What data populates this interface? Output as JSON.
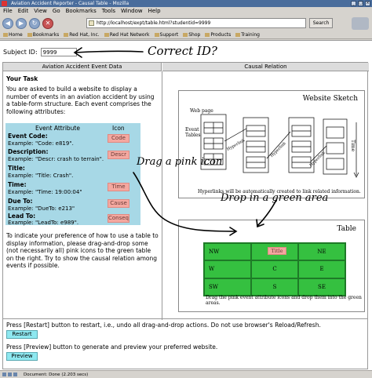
{
  "window": {
    "title": "Aviation Accident Reporter - Causal Table - Mozilla"
  },
  "menu": [
    "File",
    "Edit",
    "View",
    "Go",
    "Bookmarks",
    "Tools",
    "Window",
    "Help"
  ],
  "nav": {
    "url": "http://localhost/expt/table.html?studentid=9999",
    "search_label": "Search"
  },
  "bookmarks": [
    "Home",
    "Bookmarks",
    "Red Hat, Inc.",
    "Red Hat Network",
    "Support",
    "Shop",
    "Products",
    "Training"
  ],
  "subject": {
    "label": "Subject ID:",
    "value": "9999"
  },
  "annotations": {
    "correct_id": "Correct ID?",
    "drag": "Drag a pink icon",
    "drop": "Drop in a green area"
  },
  "left": {
    "header": "Aviation Accident Event Data",
    "task_title": "Your Task",
    "task_desc": "You are asked to build a website to display a number of events in an aviation accident by using a table-form structure. Each event comprises the following attributes:",
    "attr_header": "Event Attribute",
    "icon_header": "Icon",
    "attributes": [
      {
        "label": "Event Code:",
        "example": "Example: \"Code: e819\".",
        "icon": "Code"
      },
      {
        "label": "Description:",
        "example": "Example: \"Descr: crash to terrain\".",
        "icon": "Descr"
      },
      {
        "label": "Title:",
        "example": "Example: \"Title: Crash\".",
        "icon": ""
      },
      {
        "label": "Time:",
        "example": "Example: \"Time: 19:00:04\"",
        "icon": "Time"
      },
      {
        "label": "Due To:",
        "example": "Example: \"DueTo: e213\"",
        "icon": "Cause"
      },
      {
        "label": "Lead To:",
        "example": "Example: \"LeadTo: e989\".",
        "icon": "Conseq"
      }
    ],
    "task_foot": "To indicate your preference of how to use a table to display information, please drag-and-drop some (not necessarily all) pink icons to the green table on the right. Try to show the causal relation among events if possible."
  },
  "right": {
    "header": "Causal Relation",
    "sketch": {
      "title": "Website Sketch",
      "web_page": "Web page",
      "event_tables": "Event Tables",
      "time": "Time",
      "hyperlink": "Hyperlink",
      "caption": "Hyperlinks will be automatically created to link related information."
    },
    "table": {
      "title": "Table",
      "cells": [
        "NW",
        "Title",
        "NE",
        "W",
        "C",
        "E",
        "SW",
        "S",
        "SE"
      ],
      "caption": "Drag the pink event attribute icons and drop them into the green areas."
    }
  },
  "bottom": {
    "restart_text": "Press [Restart] button to restart, i.e., undo all drag-and-drop actions. Do not use browser's Reload/Refresh.",
    "restart_btn": "Restart",
    "preview_text": "Press [Preview] button to generate and preview your preferred website.",
    "preview_btn": "Preview"
  },
  "status": {
    "text": "Document: Done (2.203 secs)"
  }
}
